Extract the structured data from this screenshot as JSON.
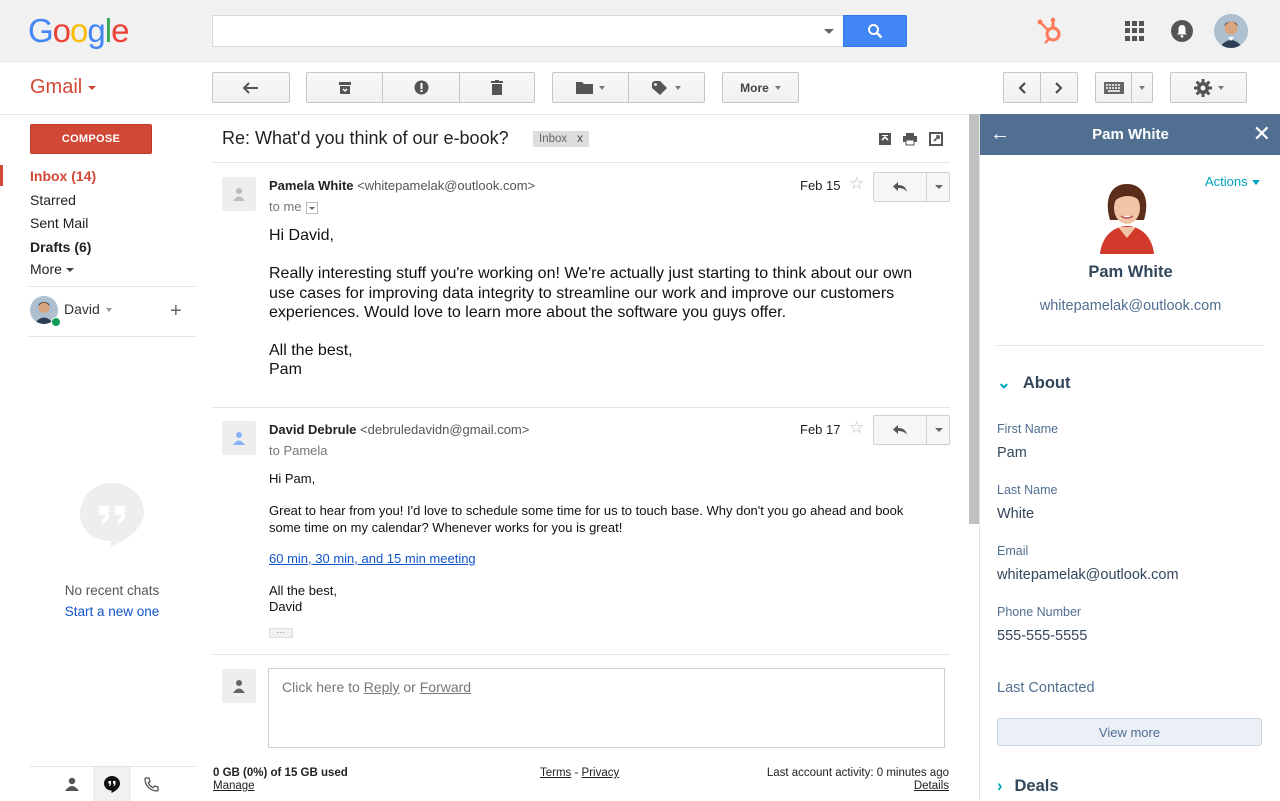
{
  "header": {
    "logo_letters": [
      "G",
      "o",
      "o",
      "g",
      "l",
      "e"
    ],
    "logo_colors": [
      "#4285f4",
      "#ea4335",
      "#fbbc05",
      "#4285f4",
      "#34a853",
      "#ea4335"
    ],
    "search_value": ""
  },
  "app": {
    "name": "Gmail",
    "more_label": "More"
  },
  "nav": {
    "compose": "COMPOSE",
    "inbox": "Inbox (14)",
    "starred": "Starred",
    "sent": "Sent Mail",
    "drafts": "Drafts (6)",
    "more": "More"
  },
  "chat": {
    "user": "David",
    "no_recent": "No recent chats",
    "start_new": "Start a new one"
  },
  "thread": {
    "subject": "Re: What'd you think of our e-book?",
    "label_chip": "Inbox",
    "label_chip_close": "x",
    "messages": [
      {
        "sender_name": "Pamela White",
        "sender_email": "<whitepamelak@outlook.com>",
        "to": "to me",
        "date": "Feb 15",
        "greeting": "Hi David,",
        "paragraph": "Really interesting stuff you're working on! We're actually just starting to think about our own use cases for improving data integrity to streamline our work and improve our customers experiences. Would love to learn more about the software you guys offer.",
        "signoff": "All the best,",
        "signature": "Pam"
      },
      {
        "sender_name": "David Debrule",
        "sender_email": "<debruledavidn@gmail.com>",
        "to": "to Pamela",
        "date": "Feb 17",
        "greeting": "Hi Pam,",
        "paragraph": "Great to hear from you! I'd love to schedule some time for us to touch base. Why don't you go ahead and book some time on my calendar? Whenever works for you is great!",
        "link": "60 min, 30 min, and 15 min meeting",
        "signoff": "All the best,",
        "signature": "David",
        "ellipsis": "···"
      }
    ],
    "reply_prompt_start": "Click here to ",
    "reply_link": "Reply",
    "reply_or": " or ",
    "forward_link": "Forward"
  },
  "footer": {
    "storage": "0 GB (0%) of 15 GB used",
    "manage": "Manage",
    "terms": "Terms",
    "separator": " - ",
    "privacy": "Privacy",
    "last_activity": "Last account activity: 0 minutes ago",
    "details": "Details"
  },
  "hubspot": {
    "title": "Pam White",
    "actions": "Actions",
    "name": "Pam White",
    "email": "whitepamelak@outlook.com",
    "about": "About",
    "fields": [
      {
        "label": "First Name",
        "value": "Pam"
      },
      {
        "label": "Last Name",
        "value": "White"
      },
      {
        "label": "Email",
        "value": "whitepamelak@outlook.com"
      },
      {
        "label": "Phone Number",
        "value": "555-555-5555"
      },
      {
        "label": "Last Contacted",
        "value": ""
      }
    ],
    "view_more": "View more",
    "deals": "Deals",
    "accent_color": "#516f90",
    "link_color": "#00a4bd"
  }
}
